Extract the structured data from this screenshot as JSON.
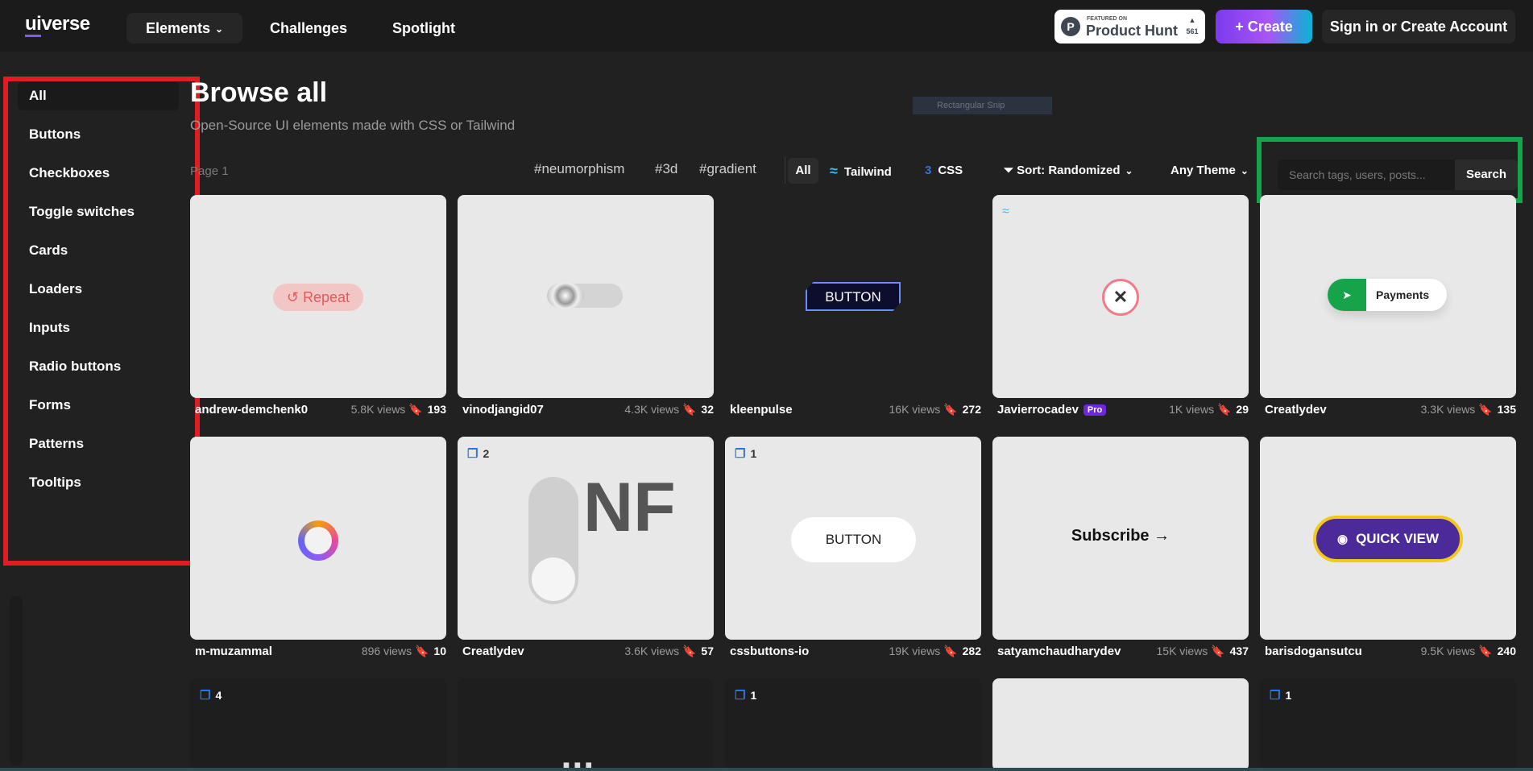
{
  "header": {
    "logo_ui": "ui",
    "logo_verse": "verse",
    "nav": [
      "Elements",
      "Challenges",
      "Spotlight"
    ],
    "product_hunt": {
      "small": "FEATURED ON",
      "name": "Product Hunt",
      "count": "561",
      "arrow": "▲"
    },
    "create_label": "Create",
    "signin_label": "Sign in or Create Account"
  },
  "sidebar": {
    "items": [
      "All",
      "Buttons",
      "Checkboxes",
      "Toggle switches",
      "Cards",
      "Loaders",
      "Inputs",
      "Radio buttons",
      "Forms",
      "Patterns",
      "Tooltips"
    ]
  },
  "main": {
    "title": "Browse all",
    "subtitle": "Open-Source UI elements made with CSS or Tailwind",
    "snip_overlay": "Rectangular Snip",
    "page_label": "Page 1",
    "tags": [
      "#neumorphism",
      "#3d",
      "#gradient"
    ],
    "filters": {
      "all": "All",
      "tailwind": "Tailwind",
      "css": "CSS"
    },
    "sort_label": "Sort: Randomized",
    "theme_label": "Any Theme",
    "search": {
      "placeholder": "Search tags, users, posts...",
      "button": "Search"
    }
  },
  "cards": [
    {
      "author": "andrew-demchenk0",
      "views": "5.8K views",
      "saves": "193",
      "preview": "Repeat"
    },
    {
      "author": "vinodjangid07",
      "views": "4.3K views",
      "saves": "32"
    },
    {
      "author": "kleenpulse",
      "views": "16K views",
      "saves": "272",
      "preview": "BUTTON"
    },
    {
      "author": "Javierrocadev",
      "badge": "Pro",
      "views": "1K views",
      "saves": "29"
    },
    {
      "author": "Creatlydev",
      "views": "3.3K views",
      "saves": "135",
      "preview": "Payments"
    },
    {
      "author": "m-muzammal",
      "views": "896 views",
      "saves": "10"
    },
    {
      "author": "Creatlydev",
      "views": "3.6K views",
      "saves": "57",
      "count": "2",
      "preview": "NF"
    },
    {
      "author": "cssbuttons-io",
      "views": "19K views",
      "saves": "282",
      "count": "1",
      "preview": "BUTTON"
    },
    {
      "author": "satyamchaudharydev",
      "views": "15K views",
      "saves": "437",
      "preview": "Subscribe →"
    },
    {
      "author": "barisdogansutcu",
      "views": "9.5K views",
      "saves": "240",
      "preview": "QUICK VIEW"
    }
  ],
  "row3_counts": [
    "4",
    "1",
    "1"
  ],
  "icons": [
    "chevron-down-icon",
    "plus-icon",
    "filter-icon",
    "tailwind-icon",
    "css-icon",
    "bookmark-icon",
    "copy-icon",
    "eye-icon",
    "send-icon",
    "close-icon",
    "undo-icon"
  ],
  "colors": {
    "accent": "#7c3aed",
    "sidebar_highlight": "#e11d24",
    "search_highlight": "#16a34a"
  }
}
